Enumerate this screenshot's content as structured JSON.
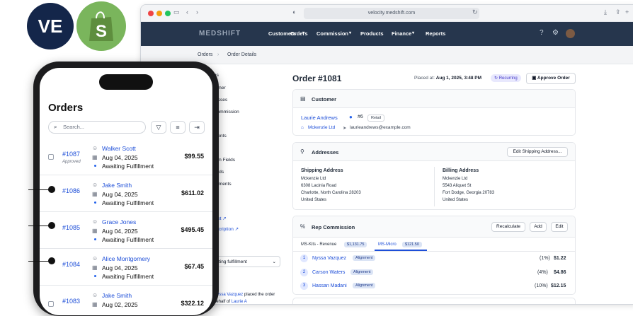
{
  "logos": {
    "ve": "VE",
    "shopify": "S"
  },
  "browser": {
    "url": "velocity.medshift.com"
  },
  "nav": {
    "brand": "MEDSHIFT",
    "items": [
      "Customers",
      "Orders",
      "Commission",
      "Products",
      "Finance",
      "Reports"
    ]
  },
  "breadcrumb": {
    "root": "Orders",
    "current": "Order Details"
  },
  "order": {
    "title": "Order #1081",
    "placed_label": "Placed at:",
    "placed_value": "Aug 1, 2025, 3:48 PM",
    "recurring": "Recurring",
    "approve": "Approve Order"
  },
  "customer": {
    "header": "Customer",
    "name": "Laurie Andrews",
    "number": "#6",
    "tier": "Retail",
    "company": "Mckenzie Ltd",
    "email": "laurieandrews@example.com"
  },
  "addresses": {
    "header": "Addresses",
    "edit": "Edit Shipping Address...",
    "shipping": {
      "label": "Shipping Address",
      "lines": [
        "Mckenzie Ltd",
        "6308 Lacinia Road",
        "Charlotte, North Carolina 28203",
        "United States"
      ]
    },
    "billing": {
      "label": "Billing Address",
      "lines": [
        "Mckenzie Ltd",
        "5543 Aliquet St",
        "Fort Dodge, Georgia 20783",
        "United States"
      ]
    }
  },
  "commission": {
    "header": "Rep Commission",
    "buttons": [
      "Recalculate",
      "Add",
      "Edit"
    ],
    "tabs": [
      {
        "label": "MS-Kits - Revenue",
        "value": "$1,131.75"
      },
      {
        "label": "MS-Micro",
        "value": "$121.50"
      }
    ],
    "reps": [
      {
        "n": "1",
        "name": "Nyssa Vazquez",
        "tag": "Alignment",
        "pct": "(1%)",
        "amt": "$1.22"
      },
      {
        "n": "2",
        "name": "Carson Waters",
        "tag": "Alignment",
        "pct": "(4%)",
        "amt": "$4.86"
      },
      {
        "n": "3",
        "name": "Hassan Madani",
        "tag": "Alignment",
        "pct": "(10%)",
        "amt": "$12.15"
      }
    ]
  },
  "sidebar_partial": [
    "ns",
    "tomer",
    "resses",
    "Commission",
    "ments",
    "ts",
    "tom Fields",
    "ands",
    "chments",
    "eipt ↗",
    "bscription ↗",
    "ting fulfillment"
  ],
  "activity": {
    "name": "Nyssa Vazquez",
    "text": "placed the order",
    "text2": "behalf of",
    "name2": "Laurie A"
  },
  "phone": {
    "title": "Orders",
    "search_placeholder": "Search...",
    "orders": [
      {
        "id": "#1087",
        "approved": "Approved",
        "customer": "Walker Scott",
        "date": "Aug 04, 2025",
        "status": "Awaiting Fulfillment",
        "amount": "$99.55"
      },
      {
        "id": "#1086",
        "approved": "",
        "customer": "Jake Smith",
        "date": "Aug 04, 2025",
        "status": "Awaiting Fulfillment",
        "amount": "$611.02"
      },
      {
        "id": "#1085",
        "approved": "",
        "customer": "Grace Jones",
        "date": "Aug 04, 2025",
        "status": "Awaiting Fulfillment",
        "amount": "$495.45"
      },
      {
        "id": "#1084",
        "approved": "",
        "customer": "Alice Montgomery",
        "date": "Aug 04, 2025",
        "status": "Awaiting Fulfillment",
        "amount": "$67.45"
      },
      {
        "id": "#1083",
        "approved": "",
        "customer": "Jake Smith",
        "date": "Aug 02, 2025",
        "status": "",
        "amount": "$322.12"
      }
    ]
  }
}
